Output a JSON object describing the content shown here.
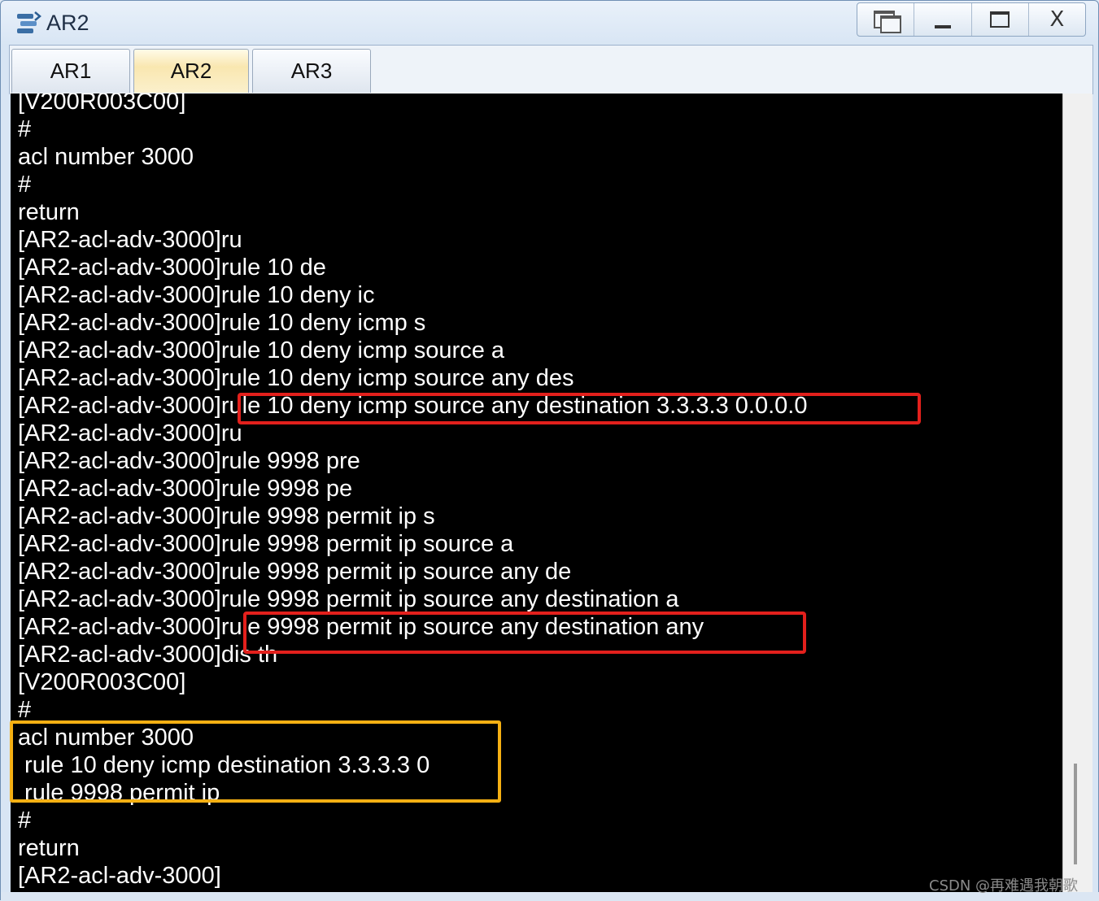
{
  "window": {
    "title": "AR2",
    "icon": "router-app-icon",
    "controls": [
      "restore-icon",
      "minimize-icon",
      "maximize-icon",
      "close-icon"
    ],
    "close_glyph": "X"
  },
  "tabs": [
    {
      "label": "AR1",
      "active": false
    },
    {
      "label": "AR2",
      "active": true
    },
    {
      "label": "AR3",
      "active": false
    }
  ],
  "terminal": {
    "lines": [
      "[V200R003C00]",
      "#",
      "acl number 3000",
      "#",
      "return",
      "[AR2-acl-adv-3000]ru",
      "[AR2-acl-adv-3000]rule 10 de",
      "[AR2-acl-adv-3000]rule 10 deny ic",
      "[AR2-acl-adv-3000]rule 10 deny icmp s",
      "[AR2-acl-adv-3000]rule 10 deny icmp source a",
      "[AR2-acl-adv-3000]rule 10 deny icmp source any des",
      "[AR2-acl-adv-3000]rule 10 deny icmp source any destination 3.3.3.3 0.0.0.0",
      "[AR2-acl-adv-3000]ru",
      "[AR2-acl-adv-3000]rule 9998 pre",
      "[AR2-acl-adv-3000]rule 9998 pe",
      "[AR2-acl-adv-3000]rule 9998 permit ip s",
      "[AR2-acl-adv-3000]rule 9998 permit ip source a",
      "[AR2-acl-adv-3000]rule 9998 permit ip source any de",
      "[AR2-acl-adv-3000]rule 9998 permit ip source any destination a",
      "[AR2-acl-adv-3000]rule 9998 permit ip source any destination any",
      "[AR2-acl-adv-3000]dis th",
      "[V200R003C00]",
      "#",
      "acl number 3000",
      " rule 10 deny icmp destination 3.3.3.3 0",
      " rule 9998 permit ip",
      "#",
      "return",
      "[AR2-acl-adv-3000]"
    ]
  },
  "annotations": {
    "red_color": "#e3201c",
    "yellow_color": "#f5b013"
  },
  "watermark": "CSDN @再难遇我朝歌"
}
